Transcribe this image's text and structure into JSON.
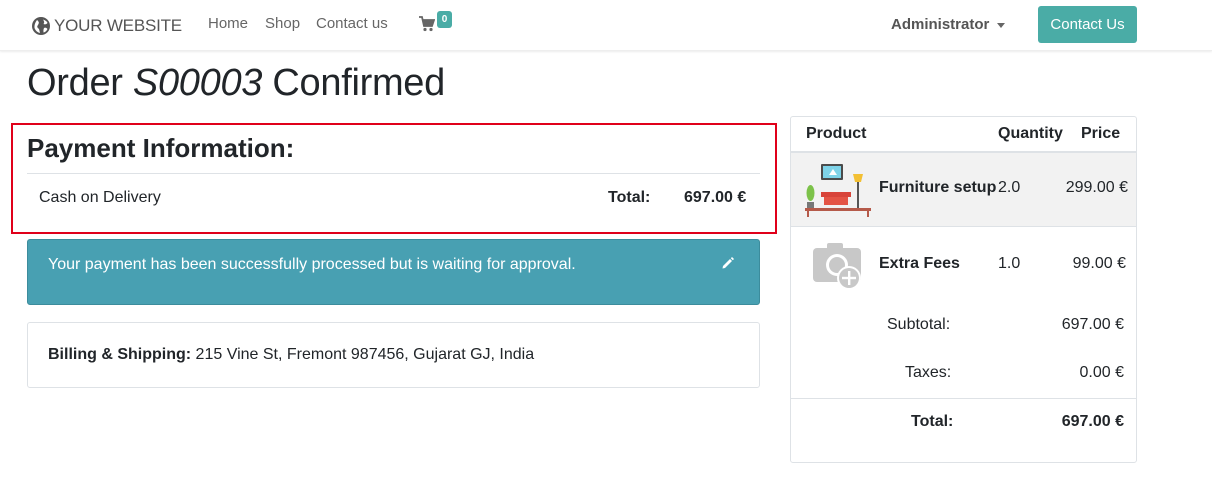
{
  "navbar": {
    "brand": "YOUR WEBSITE",
    "links": [
      "Home",
      "Shop",
      "Contact us"
    ],
    "cart_count": "0",
    "user": "Administrator",
    "contact_button": "Contact Us"
  },
  "order": {
    "title_prefix": "Order",
    "number": "S00003",
    "title_suffix": "Confirmed"
  },
  "payment": {
    "heading": "Payment Information:",
    "method": "Cash on Delivery",
    "total_label": "Total:",
    "total_value": "697.00 €"
  },
  "alert": {
    "message": "Your payment has been successfully processed but is waiting for approval."
  },
  "billing": {
    "label": "Billing & Shipping:",
    "address": "215 Vine St, Fremont 987456, Gujarat GJ, India"
  },
  "summary": {
    "headers": [
      "Product",
      "Quantity",
      "Price"
    ],
    "lines": [
      {
        "name": "Furniture setup",
        "qty": "2.0",
        "price": "299.00 €"
      },
      {
        "name": "Extra Fees",
        "qty": "1.0",
        "price": "99.00 €"
      }
    ],
    "subtotal_label": "Subtotal:",
    "subtotal_value": "697.00 €",
    "taxes_label": "Taxes:",
    "taxes_value": "0.00 €",
    "total_label": "Total:",
    "total_value": "697.00 €"
  },
  "colors": {
    "brand_teal": "#4aaca6",
    "alert_bg": "#48a0b2",
    "highlight_red": "#e0001a"
  },
  "icons": [
    "globe-icon",
    "cart-icon",
    "caret-down-icon",
    "edit-pencil-icon",
    "furniture-image",
    "camera-placeholder-icon"
  ]
}
